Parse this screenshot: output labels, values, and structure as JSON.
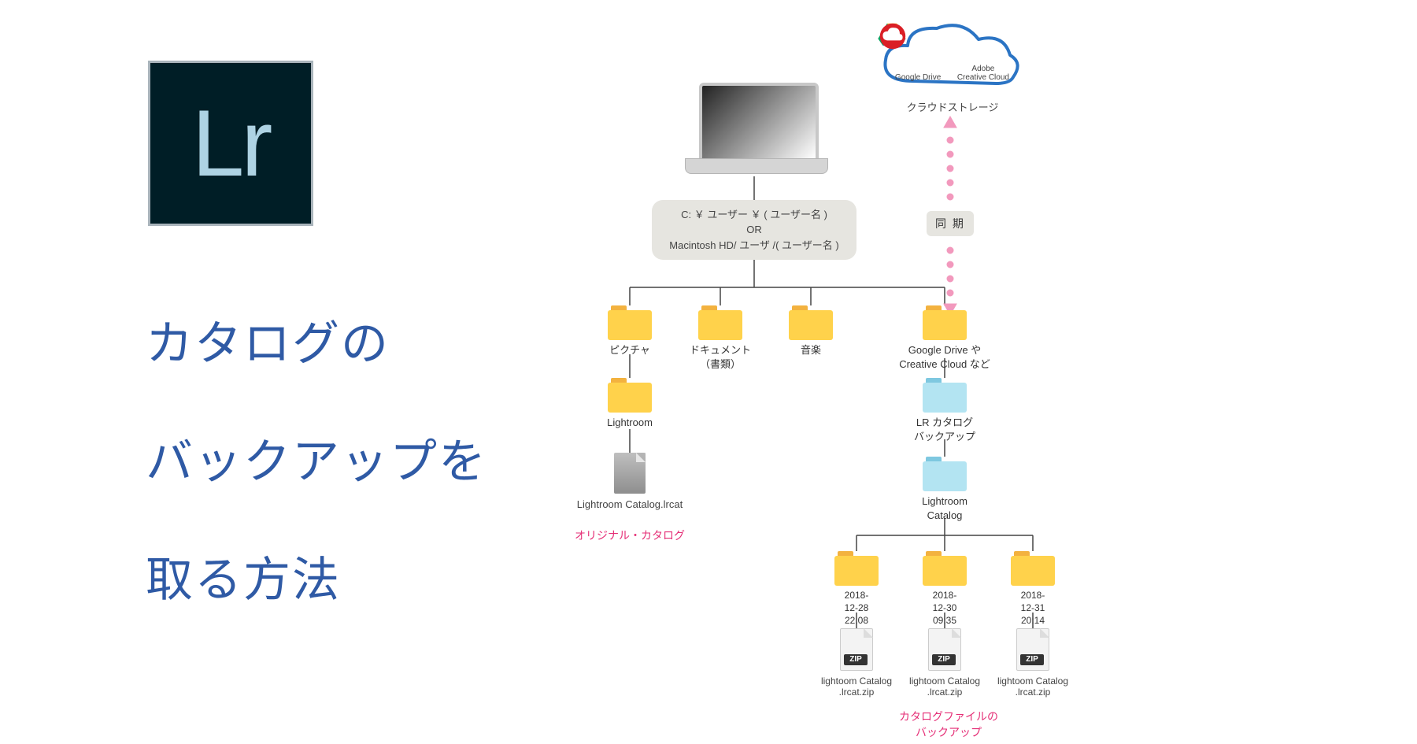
{
  "logo": {
    "label": "Lr"
  },
  "title": {
    "line1": "カタログの",
    "line2": "バックアップを",
    "line3": "取る方法"
  },
  "cloud": {
    "gd_label": "Google Drive",
    "cc_label": "Adobe\nCreative Cloud",
    "caption": "クラウドストレージ"
  },
  "sync": {
    "label": "同 期"
  },
  "path": {
    "line1": "C: ￥ ユーザー ￥ ( ユーザー名 )",
    "or": "OR",
    "line2": "Macintosh HD/ ユーザ /( ユーザー名 )"
  },
  "folders": {
    "pictures": "ピクチャ",
    "documents": "ドキュメント\n（書類）",
    "music": "音楽",
    "cloud": "Google Drive や\nCreative Cloud など",
    "lightroom": "Lightroom",
    "lr_backup": "LR カタログ\nバックアップ",
    "lr_catalog": "Lightroom\nCatalog",
    "date1": "2018-\n12-28\n22:08",
    "date2": "2018-\n12-30\n09:35",
    "date3": "2018-\n12-31\n20:14"
  },
  "files": {
    "original": "Lightroom Catalog.lrcat",
    "zip_label": "ZIP",
    "zip_file": "lightoom Catalog\n.lrcat.zip"
  },
  "captions": {
    "original": "オリジナル・カタログ",
    "backup": "カタログファイルの\nバックアップ"
  }
}
